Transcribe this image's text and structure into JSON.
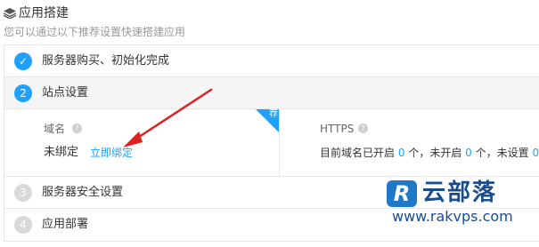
{
  "header": {
    "title": "应用搭建",
    "subtitle": "您可以通过以下推荐设置快速搭建应用",
    "icon": "layers-icon"
  },
  "steps": [
    {
      "badge": "✓",
      "label": "服务器购买、初始化完成",
      "state": "done"
    },
    {
      "badge": "2",
      "label": "站点设置",
      "state": "active"
    },
    {
      "badge": "3",
      "label": "服务器安全设置",
      "state": "todo"
    },
    {
      "badge": "4",
      "label": "应用部署",
      "state": "todo"
    }
  ],
  "domain": {
    "label": "域名",
    "value": "未绑定",
    "action": "立即绑定",
    "corner_tag": "荐"
  },
  "https": {
    "label": "HTTPS",
    "prefix": "目前域名已开启",
    "enabled": "0",
    "unit1": "个，未开启",
    "disabled": "0",
    "unit2": "个，未设置",
    "unset": "0",
    "unit3": "个"
  },
  "watermark": {
    "logo": "R",
    "brand": "云部落",
    "url": "www.rakvps.com"
  },
  "colors": {
    "accent": "#20a0ff",
    "arrow": "#e02020",
    "watermark": "#1a4d8f"
  }
}
